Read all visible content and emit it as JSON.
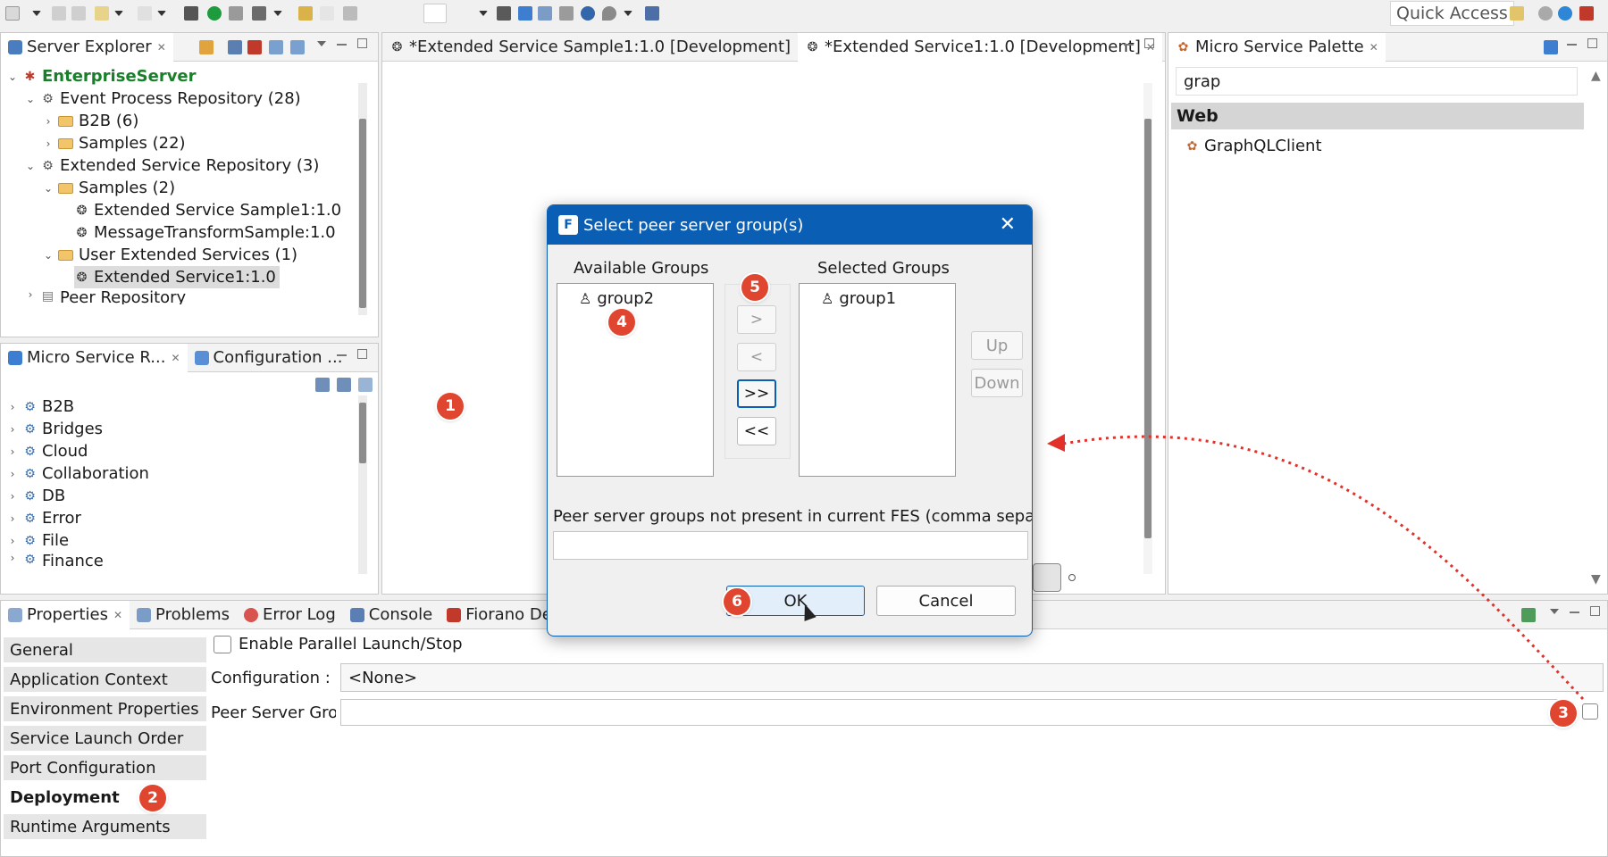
{
  "toolbar": {
    "quick_access": "Quick Access"
  },
  "server_explorer": {
    "tab_label": "Server Explorer",
    "root": "EnterpriseServer",
    "items": [
      {
        "label": "Event Process Repository (28)"
      },
      {
        "label": "B2B (6)"
      },
      {
        "label": "Samples (22)"
      },
      {
        "label": "Extended Service Repository (3)"
      },
      {
        "label": "Samples (2)"
      },
      {
        "label": "Extended Service Sample1:1.0"
      },
      {
        "label": "MessageTransformSample:1.0"
      },
      {
        "label": "User Extended Services (1)"
      },
      {
        "label": "Extended Service1:1.0"
      },
      {
        "label": "Peer Repository"
      }
    ]
  },
  "editor": {
    "tabs": [
      {
        "label": "*Extended Service Sample1:1.0 [Development]"
      },
      {
        "label": "*Extended Service1:1.0 [Development]"
      }
    ]
  },
  "palette": {
    "tab_label": "Micro Service Palette",
    "search_value": "grap",
    "category": "Web",
    "items": [
      {
        "label": "GraphQLClient"
      }
    ]
  },
  "micro_service_repo": {
    "tabs": [
      {
        "label": "Micro Service R..."
      },
      {
        "label": "Configuration ..."
      }
    ],
    "items": [
      {
        "label": "B2B"
      },
      {
        "label": "Bridges"
      },
      {
        "label": "Cloud"
      },
      {
        "label": "Collaboration"
      },
      {
        "label": "DB"
      },
      {
        "label": "Error"
      },
      {
        "label": "File"
      },
      {
        "label": "Finance"
      }
    ]
  },
  "bottom": {
    "tabs": [
      {
        "label": "Properties"
      },
      {
        "label": "Problems"
      },
      {
        "label": "Error Log"
      },
      {
        "label": "Console"
      },
      {
        "label": "Fiorano Debugger"
      }
    ],
    "side_items": [
      {
        "label": "General"
      },
      {
        "label": "Application Context"
      },
      {
        "label": "Environment Properties"
      },
      {
        "label": "Service Launch Order"
      },
      {
        "label": "Port Configuration"
      },
      {
        "label": "Deployment"
      },
      {
        "label": "Runtime Arguments"
      }
    ],
    "enable_parallel_label": "Enable Parallel Launch/Stop",
    "configuration_label": "Configuration :",
    "configuration_value": "<None>",
    "peer_server_label": "Peer Server Group",
    "peer_server_value": ""
  },
  "dialog": {
    "title": "Select peer server group(s)",
    "available_label": "Available Groups",
    "available": [
      {
        "label": "group2"
      }
    ],
    "selected_label": "Selected Groups",
    "selected": [
      {
        "label": "group1"
      }
    ],
    "btn_add": ">",
    "btn_remove": "<",
    "btn_add_all": ">>",
    "btn_remove_all": "<<",
    "btn_up": "Up",
    "btn_down": "Down",
    "not_present_label": "Peer server groups not present in current FES (comma separated)",
    "not_present_value": "",
    "ok": "OK",
    "cancel": "Cancel"
  },
  "annotations": [
    "1",
    "2",
    "3",
    "4",
    "5",
    "6"
  ],
  "colors": {
    "accent": "#0a5fb4",
    "badge": "#e0452f",
    "root_green": "#1a7f2a"
  }
}
